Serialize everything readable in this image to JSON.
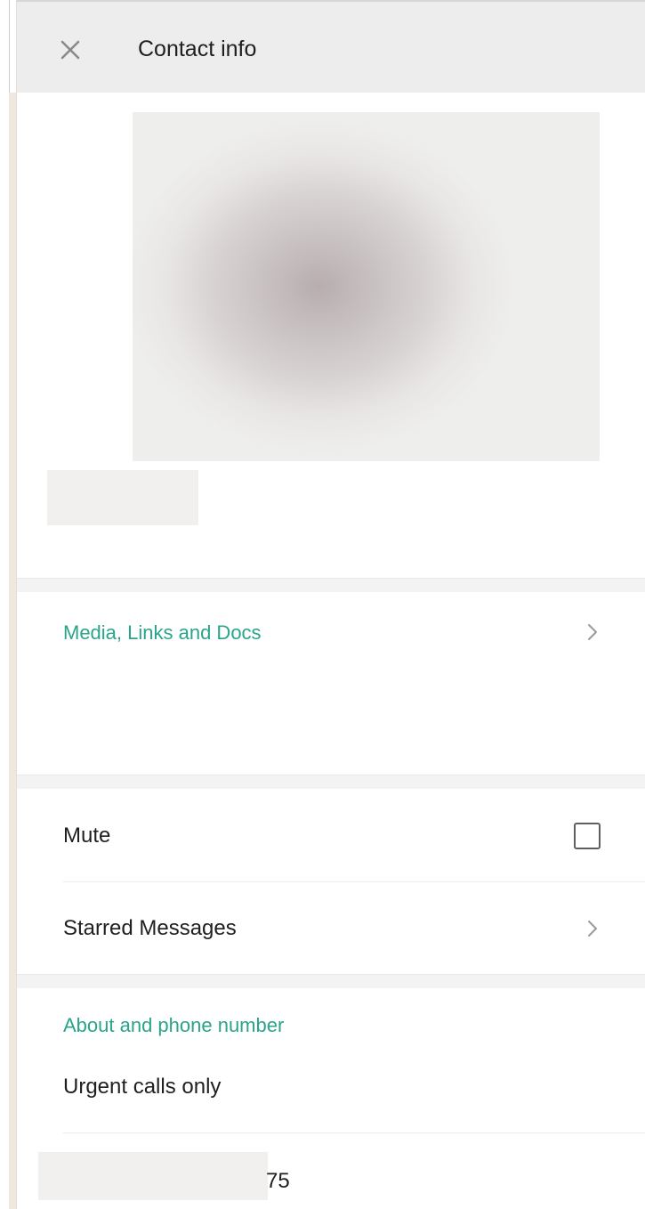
{
  "header": {
    "title": "Contact info",
    "close_icon": "close-icon"
  },
  "profile": {
    "photo": "blurred-profile-photo",
    "name_redacted": true
  },
  "media": {
    "label": "Media, Links and Docs",
    "chevron_icon": "chevron-right-icon"
  },
  "settings": {
    "mute_label": "Mute",
    "mute_checked": false,
    "starred_label": "Starred Messages",
    "chevron_icon": "chevron-right-icon"
  },
  "about": {
    "label": "About and phone number",
    "status": "Urgent calls only",
    "phone_visible_suffix": "75"
  },
  "colors": {
    "accent": "#2aa48a",
    "header_bg": "#ededed",
    "band_bg": "#f3f3f3",
    "text": "#1f1f1f"
  }
}
